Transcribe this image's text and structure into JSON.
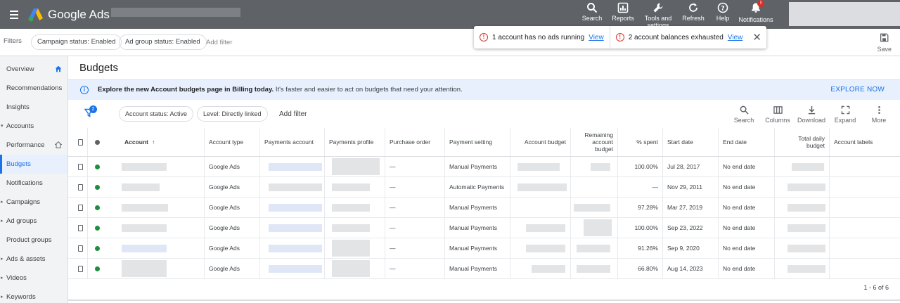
{
  "app": {
    "name": "Google Ads",
    "top_actions": [
      {
        "label": "Search",
        "icon": "search-icon"
      },
      {
        "label": "Reports",
        "icon": "reports-icon"
      },
      {
        "label": "Tools and settings",
        "icon": "wrench-icon"
      },
      {
        "label": "Refresh",
        "icon": "refresh-icon"
      },
      {
        "label": "Help",
        "icon": "help-icon"
      },
      {
        "label": "Notifications",
        "icon": "bell-icon"
      }
    ],
    "notification_badge": "!"
  },
  "filters": {
    "label": "Filters",
    "chips": [
      "Campaign status: Enabled",
      "Ad group status: Enabled"
    ],
    "add_filter": "Add filter",
    "save_label": "Save"
  },
  "toast": {
    "msg1": "1 account has no ads running",
    "msg2": "2 account balances exhausted",
    "view_label": "View"
  },
  "sidebar": {
    "items": [
      {
        "label": "Overview",
        "home": true
      },
      {
        "label": "Recommendations"
      },
      {
        "label": "Insights"
      },
      {
        "label": "Accounts",
        "caret": "open"
      },
      {
        "label": "Performance",
        "home": true
      },
      {
        "label": "Budgets",
        "active": true
      },
      {
        "label": "Notifications"
      },
      {
        "label": "Campaigns",
        "caret": "closed"
      },
      {
        "label": "Ad groups",
        "caret": "closed"
      },
      {
        "label": "Product groups"
      },
      {
        "label": "Ads & assets",
        "caret": "closed"
      },
      {
        "label": "Videos",
        "caret": "closed"
      },
      {
        "label": "Keywords",
        "caret": "closed"
      }
    ]
  },
  "page": {
    "title": "Budgets",
    "banner_bold": "Explore the new Account budgets page in Billing today.",
    "banner_text": " It's faster and easier to act on budgets that need your attention.",
    "banner_action": "EXPLORE NOW"
  },
  "toolbar": {
    "filter_count": "2",
    "chips": [
      "Account status: Active",
      "Level: Directly linked"
    ],
    "add_filter": "Add filter",
    "tools": [
      {
        "label": "Search",
        "icon": "search-icon"
      },
      {
        "label": "Columns",
        "icon": "columns-icon"
      },
      {
        "label": "Download",
        "icon": "download-icon"
      },
      {
        "label": "Expand",
        "icon": "expand-icon"
      },
      {
        "label": "More",
        "icon": "more-vert-icon"
      }
    ]
  },
  "table": {
    "headers": {
      "account": "Account",
      "account_type": "Account type",
      "payments_account": "Payments account",
      "payments_profile": "Payments profile",
      "purchase_order": "Purchase order",
      "payment_setting": "Payment setting",
      "account_budget": "Account budget",
      "remaining": "Remaining account budget",
      "spent": "% spent",
      "start": "Start date",
      "end": "End date",
      "total_daily": "Total daily budget",
      "labels": "Account labels"
    },
    "rows": [
      {
        "account_type": "Google Ads",
        "purchase_order": "—",
        "payment_setting": "Manual Payments",
        "spent": "100.00%",
        "start": "Jul 28, 2017",
        "end": "No end date"
      },
      {
        "account_type": "Google Ads",
        "purchase_order": "—",
        "payment_setting": "Automatic Payments",
        "spent": "—",
        "start": "Nov 29, 2011",
        "end": "No end date"
      },
      {
        "account_type": "Google Ads",
        "purchase_order": "—",
        "payment_setting": "Manual Payments",
        "spent": "97.28%",
        "start": "Mar 27, 2019",
        "end": "No end date"
      },
      {
        "account_type": "Google Ads",
        "purchase_order": "—",
        "payment_setting": "Manual Payments",
        "spent": "100.00%",
        "start": "Sep 23, 2022",
        "end": "No end date"
      },
      {
        "account_type": "Google Ads",
        "purchase_order": "—",
        "payment_setting": "Manual Payments",
        "spent": "91.26%",
        "start": "Sep 9, 2020",
        "end": "No end date"
      },
      {
        "account_type": "Google Ads",
        "purchase_order": "—",
        "payment_setting": "Manual Payments",
        "spent": "66.80%",
        "start": "Aug 14, 2023",
        "end": "No end date"
      }
    ],
    "range": "1 - 6 of 6"
  },
  "colors": {
    "topbar": "#5f6368",
    "accent": "#1a73e8",
    "status_enabled": "#1e8e3e",
    "alert": "#d93025"
  }
}
